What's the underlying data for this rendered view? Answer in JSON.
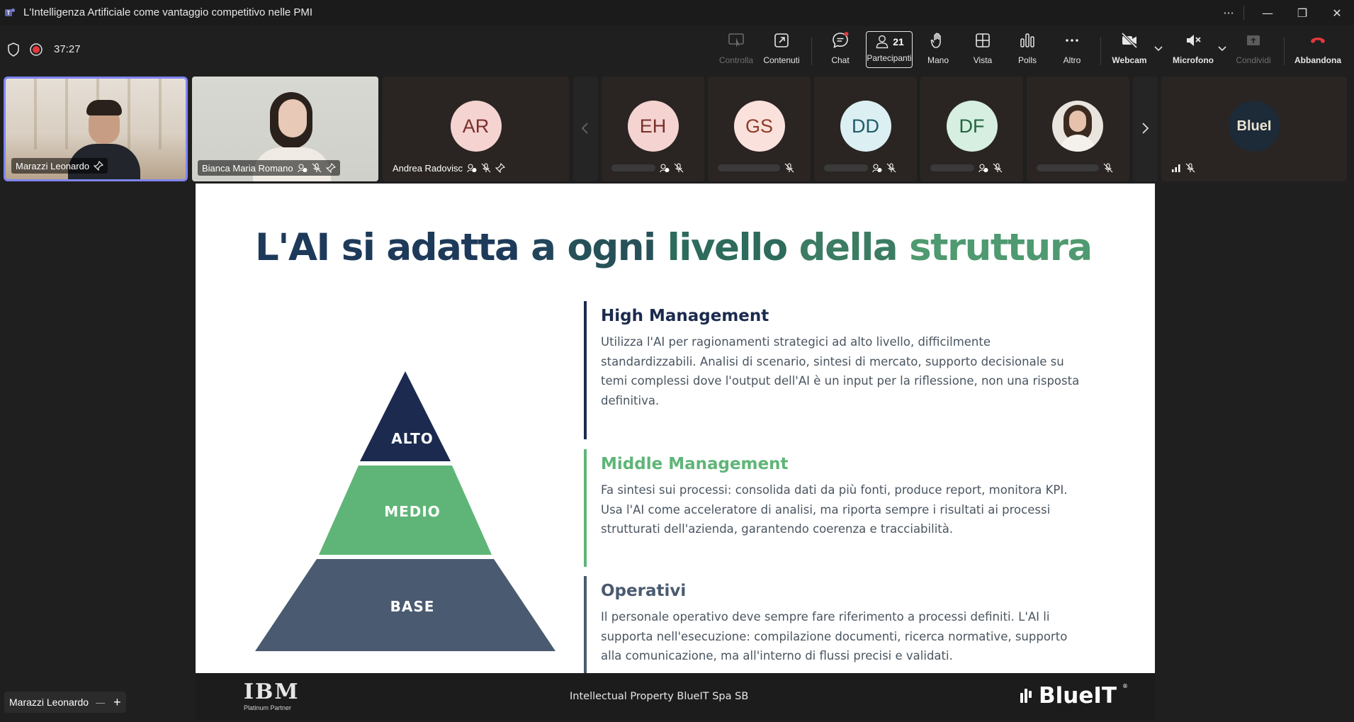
{
  "window": {
    "title": "L'Intelligenza Artificiale come vantaggio competitivo nelle PMI",
    "more_label": "···",
    "minimize_label": "—",
    "restore_label": "❐",
    "close_label": "✕"
  },
  "meeting": {
    "timer": "37:27"
  },
  "toolbar": {
    "controlla": "Controlla",
    "contenuti": "Contenuti",
    "chat": "Chat",
    "participants_count": "21",
    "partecipanti": "Partecipanti",
    "mano": "Mano",
    "vista": "Vista",
    "polls": "Polls",
    "altro": "Altro",
    "webcam": "Webcam",
    "microfono": "Microfono",
    "condividi": "Condividi",
    "abbandona": "Abbandona"
  },
  "participants": [
    {
      "name": "Marazzi Leonardo"
    },
    {
      "name": "Bianca Maria Romano"
    },
    {
      "name": "Andrea Radovisc",
      "initials": "AR",
      "color": "#f4d3d1",
      "text_color": "#7a2f2a"
    },
    {
      "initials": "EH",
      "color": "#f4d3d1",
      "text_color": "#7a2f2a"
    },
    {
      "initials": "GS",
      "color": "#fbe1dc",
      "text_color": "#8c3d26"
    },
    {
      "initials": "DD",
      "color": "#dcf0f4",
      "text_color": "#1f5b68"
    },
    {
      "initials": "DF",
      "color": "#d6efe1",
      "text_color": "#23643e"
    },
    {
      "initials": ""
    },
    {
      "initials": "",
      "logo_text": "BlueI"
    }
  ],
  "slide": {
    "title_words": [
      "L'AI",
      "si",
      "adatta",
      "a",
      "ogni",
      "livello",
      "della",
      "struttura"
    ],
    "title_colors": [
      "#1e3a5a",
      "#1e3a5a",
      "#1e3a5a",
      "#22455a",
      "#275158",
      "#2d6b5c",
      "#3b7c63",
      "#4f9a70"
    ],
    "pyramid": {
      "top": "ALTO",
      "middle": "MEDIO",
      "base": "BASE",
      "colors": {
        "top": "#1b2a4e",
        "middle": "#5fb577",
        "base": "#4a5a70"
      }
    },
    "sections": [
      {
        "heading": "High Management",
        "body": "Utilizza l'AI per ragionamenti strategici ad alto livello, difficilmente standardizzabili. Analisi di scenario, sintesi di mercato, supporto decisionale su temi complessi dove l'output dell'AI è un input per la riflessione, non una risposta definitiva.",
        "color": "#1b2a4e"
      },
      {
        "heading": "Middle Management",
        "body": "Fa sintesi sui processi: consolida dati da più fonti, produce report, monitora KPI. Usa l'AI come acceleratore di analisi, ma riporta sempre i risultati ai processi strutturati dell'azienda, garantendo coerenza e tracciabilità.",
        "color": "#5fb577"
      },
      {
        "heading": "Operativi",
        "body": "Il personale operativo deve sempre fare riferimento a processi definiti. L'AI li supporta nell'esecuzione: compilazione documenti, ricerca normative, supporto alla comunicazione, ma all'interno di flussi precisi e validati.",
        "color": "#4a5a70"
      }
    ],
    "footer": {
      "ibm": "IBM",
      "ibm_sub": "Platinum Partner",
      "center": "Intellectual Property  BlueIT Spa SB",
      "brand": "BlueIT",
      "brand_mark": "®"
    }
  },
  "bottom_bar": {
    "speaker": "Marazzi Leonardo",
    "zoom_out": "—",
    "zoom_in": "+"
  }
}
